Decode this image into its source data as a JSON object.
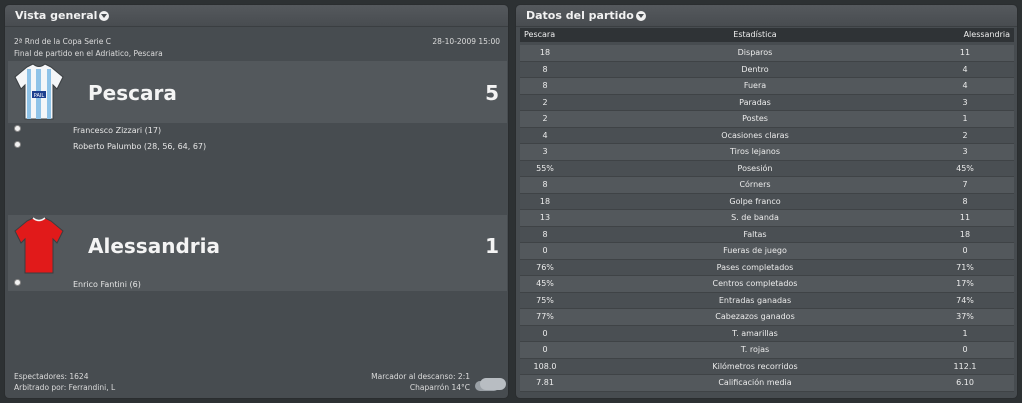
{
  "overview": {
    "title": "Vista general",
    "competition": "2ª Rnd de la Copa Serie C",
    "date": "28-10-2009 15:00",
    "venue": "Final de partido en el Adriatico, Pescara",
    "home": {
      "name": "Pescara",
      "score": "5",
      "scorers": [
        "Francesco Zizzari (17)",
        "Roberto Palumbo (28, 56, 64, 67)"
      ]
    },
    "away": {
      "name": "Alessandria",
      "score": "1",
      "scorers": [
        "Enrico Fantini (6)"
      ]
    },
    "attendance": "Espectadores: 1624",
    "referee": "Arbitrado por: Ferrandini, L",
    "halftime": "Marcador al descanso: 2:1",
    "weather": "Chaparrón 14°C"
  },
  "match_stats": {
    "title": "Datos del partido",
    "columns": [
      "Pescara",
      "Estadística",
      "Alessandria"
    ],
    "rows": [
      [
        "18",
        "Disparos",
        "11"
      ],
      [
        "8",
        "Dentro",
        "4"
      ],
      [
        "8",
        "Fuera",
        "4"
      ],
      [
        "2",
        "Paradas",
        "3"
      ],
      [
        "2",
        "Postes",
        "1"
      ],
      [
        "4",
        "Ocasiones claras",
        "2"
      ],
      [
        "3",
        "Tiros lejanos",
        "3"
      ],
      [
        "55%",
        "Posesión",
        "45%"
      ],
      [
        "8",
        "Córners",
        "7"
      ],
      [
        "18",
        "Golpe franco",
        "8"
      ],
      [
        "13",
        "S. de banda",
        "11"
      ],
      [
        "8",
        "Faltas",
        "18"
      ],
      [
        "0",
        "Fueras de juego",
        "0"
      ],
      [
        "76%",
        "Pases completados",
        "71%"
      ],
      [
        "45%",
        "Centros completados",
        "17%"
      ],
      [
        "75%",
        "Entradas ganadas",
        "74%"
      ],
      [
        "77%",
        "Cabezazos ganados",
        "37%"
      ],
      [
        "0",
        "T. amarillas",
        "1"
      ],
      [
        "0",
        "T. rojas",
        "0"
      ],
      [
        "108.0",
        "Kilómetros recorridos",
        "112.1"
      ],
      [
        "7.81",
        "Calificación media",
        "6.10"
      ]
    ]
  },
  "colors": {
    "home_shirt": "#8fc3e8",
    "away_shirt": "#e11a1a"
  },
  "icons": [
    "dropdown-arrow-icon",
    "football-icon",
    "weather-cloud-icon",
    "team-shirt-icon"
  ]
}
